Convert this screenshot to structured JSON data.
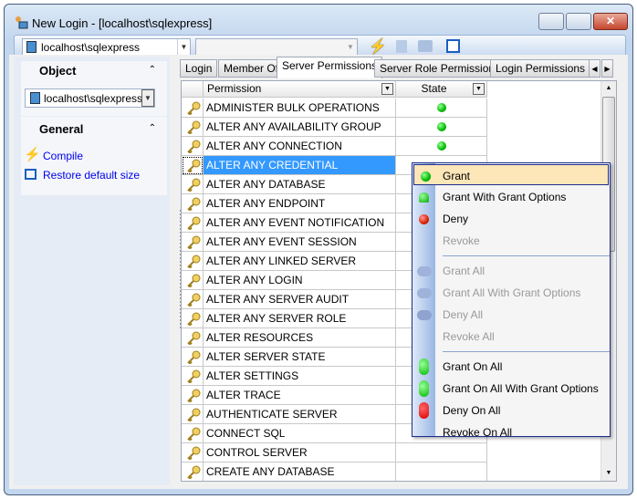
{
  "window": {
    "title": "New Login - [localhost\\sqlexpress]"
  },
  "toolbar": {
    "server_combo": "localhost\\sqlexpress",
    "database_combo": "",
    "icons": [
      "compile-icon",
      "refresh-icon",
      "print-icon",
      "restore-size-icon"
    ]
  },
  "left_panel": {
    "object": {
      "header": "Object",
      "combo": "localhost\\sqlexpress"
    },
    "general": {
      "header": "General",
      "links": [
        {
          "label": "Compile",
          "icon": "lightning-icon"
        },
        {
          "label": "Restore default size",
          "icon": "restore-window-icon"
        }
      ]
    }
  },
  "tabs": [
    {
      "label": "Login"
    },
    {
      "label": "Member Of"
    },
    {
      "label": "Server Permissions",
      "active": true
    },
    {
      "label": "Server Role Permissions"
    },
    {
      "label": "Login Permissions"
    }
  ],
  "grid": {
    "columns": [
      "Permission",
      "State"
    ],
    "rows": [
      {
        "permission": "ADMINISTER BULK OPERATIONS",
        "state": "grant"
      },
      {
        "permission": "ALTER ANY AVAILABILITY GROUP",
        "state": "grant"
      },
      {
        "permission": "ALTER ANY CONNECTION",
        "state": "grant"
      },
      {
        "permission": "ALTER ANY CREDENTIAL",
        "state": "",
        "selected": true
      },
      {
        "permission": "ALTER ANY DATABASE",
        "state": ""
      },
      {
        "permission": "ALTER ANY ENDPOINT",
        "state": ""
      },
      {
        "permission": "ALTER ANY EVENT NOTIFICATION",
        "state": ""
      },
      {
        "permission": "ALTER ANY EVENT SESSION",
        "state": ""
      },
      {
        "permission": "ALTER ANY LINKED SERVER",
        "state": ""
      },
      {
        "permission": "ALTER ANY LOGIN",
        "state": ""
      },
      {
        "permission": "ALTER ANY SERVER AUDIT",
        "state": ""
      },
      {
        "permission": "ALTER ANY SERVER ROLE",
        "state": ""
      },
      {
        "permission": "ALTER RESOURCES",
        "state": ""
      },
      {
        "permission": "ALTER SERVER STATE",
        "state": ""
      },
      {
        "permission": "ALTER SETTINGS",
        "state": ""
      },
      {
        "permission": "ALTER TRACE",
        "state": ""
      },
      {
        "permission": "AUTHENTICATE SERVER",
        "state": ""
      },
      {
        "permission": "CONNECT SQL",
        "state": ""
      },
      {
        "permission": "CONTROL SERVER",
        "state": ""
      },
      {
        "permission": "CREATE ANY DATABASE",
        "state": ""
      }
    ]
  },
  "context_menu": {
    "items": [
      {
        "label": "Grant",
        "icon": "green-dot-icon",
        "enabled": true,
        "highlighted": true
      },
      {
        "label": "Grant With Grant Options",
        "icon": "grant-option-icon",
        "enabled": true
      },
      {
        "label": "Deny",
        "icon": "deny-icon",
        "enabled": true
      },
      {
        "label": "Revoke",
        "enabled": false
      },
      {
        "separator": true
      },
      {
        "label": "Grant All",
        "icon": "grant-all-icon",
        "enabled": false
      },
      {
        "label": "Grant All With Grant Options",
        "icon": "grant-all-options-icon",
        "enabled": false
      },
      {
        "label": "Deny All",
        "icon": "deny-all-icon",
        "enabled": false
      },
      {
        "label": "Revoke All",
        "enabled": false
      },
      {
        "separator": true
      },
      {
        "label": "Grant On All",
        "icon": "grant-on-all-icon",
        "enabled": true
      },
      {
        "label": "Grant On All With Grant Options",
        "icon": "grant-on-all-options-icon",
        "enabled": true
      },
      {
        "label": "Deny On All",
        "icon": "deny-on-all-icon",
        "enabled": true
      },
      {
        "label": "Revoke On All",
        "enabled": true
      }
    ]
  },
  "colors": {
    "selection": "#3399ff",
    "menu_highlight": "#fde6b8",
    "link": "#0000ee"
  }
}
